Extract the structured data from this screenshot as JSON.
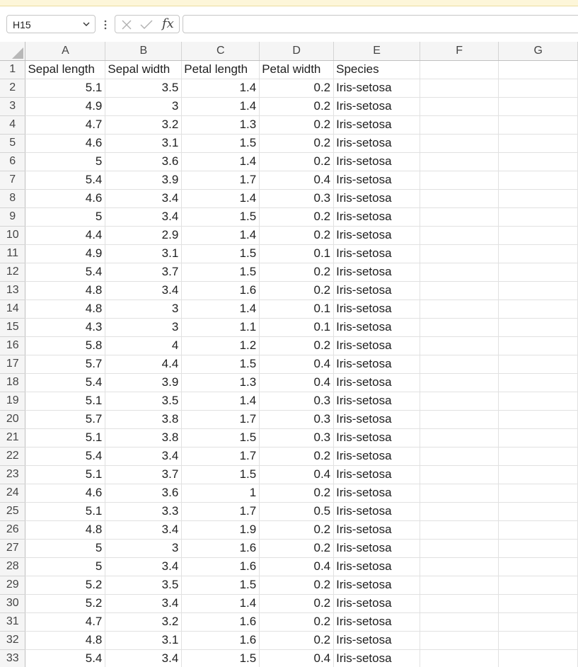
{
  "formula_bar": {
    "name_box": "H15",
    "formula": "",
    "cancel_icon": "close-icon",
    "enter_icon": "checkmark-icon",
    "function_label": "fx"
  },
  "sheet": {
    "columns": [
      "A",
      "B",
      "C",
      "D",
      "E",
      "F",
      "G"
    ],
    "rows": [
      {
        "n": "1",
        "cells": [
          "Sepal length",
          "Sepal width",
          "Petal length",
          "Petal width",
          "Species",
          "",
          ""
        ]
      },
      {
        "n": "2",
        "cells": [
          "5.1",
          "3.5",
          "1.4",
          "0.2",
          "Iris-setosa",
          "",
          ""
        ]
      },
      {
        "n": "3",
        "cells": [
          "4.9",
          "3",
          "1.4",
          "0.2",
          "Iris-setosa",
          "",
          ""
        ]
      },
      {
        "n": "4",
        "cells": [
          "4.7",
          "3.2",
          "1.3",
          "0.2",
          "Iris-setosa",
          "",
          ""
        ]
      },
      {
        "n": "5",
        "cells": [
          "4.6",
          "3.1",
          "1.5",
          "0.2",
          "Iris-setosa",
          "",
          ""
        ]
      },
      {
        "n": "6",
        "cells": [
          "5",
          "3.6",
          "1.4",
          "0.2",
          "Iris-setosa",
          "",
          ""
        ]
      },
      {
        "n": "7",
        "cells": [
          "5.4",
          "3.9",
          "1.7",
          "0.4",
          "Iris-setosa",
          "",
          ""
        ]
      },
      {
        "n": "8",
        "cells": [
          "4.6",
          "3.4",
          "1.4",
          "0.3",
          "Iris-setosa",
          "",
          ""
        ]
      },
      {
        "n": "9",
        "cells": [
          "5",
          "3.4",
          "1.5",
          "0.2",
          "Iris-setosa",
          "",
          ""
        ]
      },
      {
        "n": "10",
        "cells": [
          "4.4",
          "2.9",
          "1.4",
          "0.2",
          "Iris-setosa",
          "",
          ""
        ]
      },
      {
        "n": "11",
        "cells": [
          "4.9",
          "3.1",
          "1.5",
          "0.1",
          "Iris-setosa",
          "",
          ""
        ]
      },
      {
        "n": "12",
        "cells": [
          "5.4",
          "3.7",
          "1.5",
          "0.2",
          "Iris-setosa",
          "",
          ""
        ]
      },
      {
        "n": "13",
        "cells": [
          "4.8",
          "3.4",
          "1.6",
          "0.2",
          "Iris-setosa",
          "",
          ""
        ]
      },
      {
        "n": "14",
        "cells": [
          "4.8",
          "3",
          "1.4",
          "0.1",
          "Iris-setosa",
          "",
          ""
        ]
      },
      {
        "n": "15",
        "cells": [
          "4.3",
          "3",
          "1.1",
          "0.1",
          "Iris-setosa",
          "",
          ""
        ]
      },
      {
        "n": "16",
        "cells": [
          "5.8",
          "4",
          "1.2",
          "0.2",
          "Iris-setosa",
          "",
          ""
        ]
      },
      {
        "n": "17",
        "cells": [
          "5.7",
          "4.4",
          "1.5",
          "0.4",
          "Iris-setosa",
          "",
          ""
        ]
      },
      {
        "n": "18",
        "cells": [
          "5.4",
          "3.9",
          "1.3",
          "0.4",
          "Iris-setosa",
          "",
          ""
        ]
      },
      {
        "n": "19",
        "cells": [
          "5.1",
          "3.5",
          "1.4",
          "0.3",
          "Iris-setosa",
          "",
          ""
        ]
      },
      {
        "n": "20",
        "cells": [
          "5.7",
          "3.8",
          "1.7",
          "0.3",
          "Iris-setosa",
          "",
          ""
        ]
      },
      {
        "n": "21",
        "cells": [
          "5.1",
          "3.8",
          "1.5",
          "0.3",
          "Iris-setosa",
          "",
          ""
        ]
      },
      {
        "n": "22",
        "cells": [
          "5.4",
          "3.4",
          "1.7",
          "0.2",
          "Iris-setosa",
          "",
          ""
        ]
      },
      {
        "n": "23",
        "cells": [
          "5.1",
          "3.7",
          "1.5",
          "0.4",
          "Iris-setosa",
          "",
          ""
        ]
      },
      {
        "n": "24",
        "cells": [
          "4.6",
          "3.6",
          "1",
          "0.2",
          "Iris-setosa",
          "",
          ""
        ]
      },
      {
        "n": "25",
        "cells": [
          "5.1",
          "3.3",
          "1.7",
          "0.5",
          "Iris-setosa",
          "",
          ""
        ]
      },
      {
        "n": "26",
        "cells": [
          "4.8",
          "3.4",
          "1.9",
          "0.2",
          "Iris-setosa",
          "",
          ""
        ]
      },
      {
        "n": "27",
        "cells": [
          "5",
          "3",
          "1.6",
          "0.2",
          "Iris-setosa",
          "",
          ""
        ]
      },
      {
        "n": "28",
        "cells": [
          "5",
          "3.4",
          "1.6",
          "0.4",
          "Iris-setosa",
          "",
          ""
        ]
      },
      {
        "n": "29",
        "cells": [
          "5.2",
          "3.5",
          "1.5",
          "0.2",
          "Iris-setosa",
          "",
          ""
        ]
      },
      {
        "n": "30",
        "cells": [
          "5.2",
          "3.4",
          "1.4",
          "0.2",
          "Iris-setosa",
          "",
          ""
        ]
      },
      {
        "n": "31",
        "cells": [
          "4.7",
          "3.2",
          "1.6",
          "0.2",
          "Iris-setosa",
          "",
          ""
        ]
      },
      {
        "n": "32",
        "cells": [
          "4.8",
          "3.1",
          "1.6",
          "0.2",
          "Iris-setosa",
          "",
          ""
        ]
      },
      {
        "n": "33",
        "cells": [
          "5.4",
          "3.4",
          "1.5",
          "0.4",
          "Iris-setosa",
          "",
          ""
        ]
      }
    ]
  }
}
